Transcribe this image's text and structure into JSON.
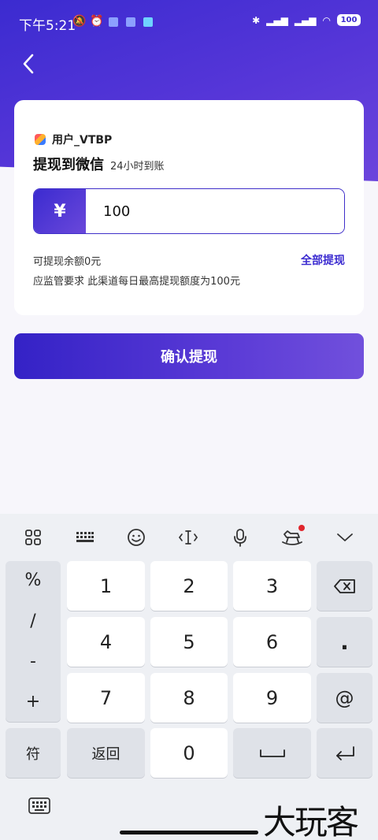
{
  "status_bar": {
    "time": "下午5:21",
    "battery": "100"
  },
  "user": {
    "name": "用户_VTBP"
  },
  "withdraw": {
    "title": "提现到微信",
    "subtitle": "24小时到账",
    "currency_symbol": "¥",
    "amount": "100",
    "balance_text": "可提现余额0元",
    "withdraw_all_label": "全部提现",
    "notice": "应监管要求 此渠道每日最高提现额度为100元"
  },
  "confirm_button": {
    "label": "确认提现"
  },
  "keyboard": {
    "side_keys": [
      "%",
      "/",
      "-",
      "+"
    ],
    "digits": [
      "1",
      "2",
      "3",
      "4",
      "5",
      "6",
      "7",
      "8",
      "9",
      "0"
    ],
    "dot": ".",
    "at": "@",
    "symbols_label": "符",
    "back_label": "返回"
  },
  "watermark": "大玩客",
  "colors": {
    "accent": "#3b2bd0",
    "accent_light": "#6b45dc",
    "notification_dot": "#e0262d"
  }
}
